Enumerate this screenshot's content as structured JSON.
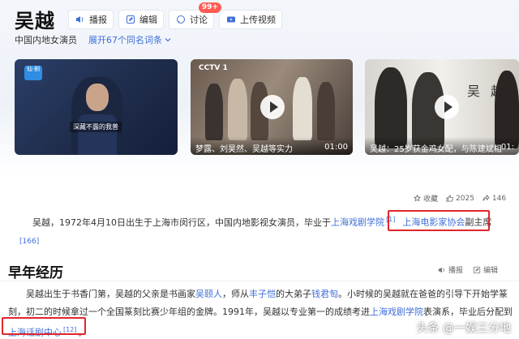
{
  "header": {
    "title": "吴越",
    "buttons": [
      {
        "label": "播报",
        "icon": "speaker-icon"
      },
      {
        "label": "编辑",
        "icon": "edit-icon"
      },
      {
        "label": "讨论",
        "icon": "chat-icon",
        "badge": "99+"
      },
      {
        "label": "上传视频",
        "icon": "upload-video-icon"
      }
    ],
    "subtitle": "中国内地女演员",
    "expand_label": "展开67个同名词条"
  },
  "videos": [
    {
      "caption": "深藏不露的我普",
      "duration": "",
      "logo": "仙·剧"
    },
    {
      "caption": "梦露、刘昊然、吴越等实力",
      "duration": "01:00",
      "logo": "CCTV 1"
    },
    {
      "caption": "吴越：25岁获金鸡女配，与陈建斌相",
      "duration": "01:",
      "logo": "吴 越"
    }
  ],
  "stats": [
    {
      "label": "收藏",
      "icon": "star-icon"
    },
    {
      "label": "2025",
      "icon": "thumb-up-icon"
    },
    {
      "label": "146",
      "icon": "share-icon"
    }
  ],
  "intro": {
    "text_a": "吴越，1972年4月10日出生于上海市闵行区，中国内地影视女演员，毕业于",
    "link_school": "上海戏剧学院",
    "ref1": "[1]",
    "link_assoc": "上海电影家协会",
    "text_b": "副主席",
    "ref2": "[166]"
  },
  "section": {
    "title": "早年经历",
    "actions": [
      {
        "label": "播报",
        "icon": "speaker-icon"
      },
      {
        "label": "编辑",
        "icon": "edit-icon"
      }
    ],
    "line1_a": "吴越出生于书香门第，吴越的父亲是书画家",
    "link_father": "吴颐人",
    "line1_b": "，师从",
    "link_master": "丰子恺",
    "line1_c": "的大弟子",
    "link_qian": "钱君匋",
    "line1_d": "。小时候的吴越就在爸爸的引导下开始学篆",
    "line2_a": "刻，初二的时候拿过一个全国篆刻比赛少年组的金牌。1991年，吴越以专业第一的成绩考进",
    "link_school2": "上海戏剧学院",
    "line2_b": "表演系，毕业后分配到",
    "link_theatre": "上海话剧中心",
    "ref3": "[12]",
    "line3_end": "。"
  },
  "watermark": "头条 @一娱三分地"
}
